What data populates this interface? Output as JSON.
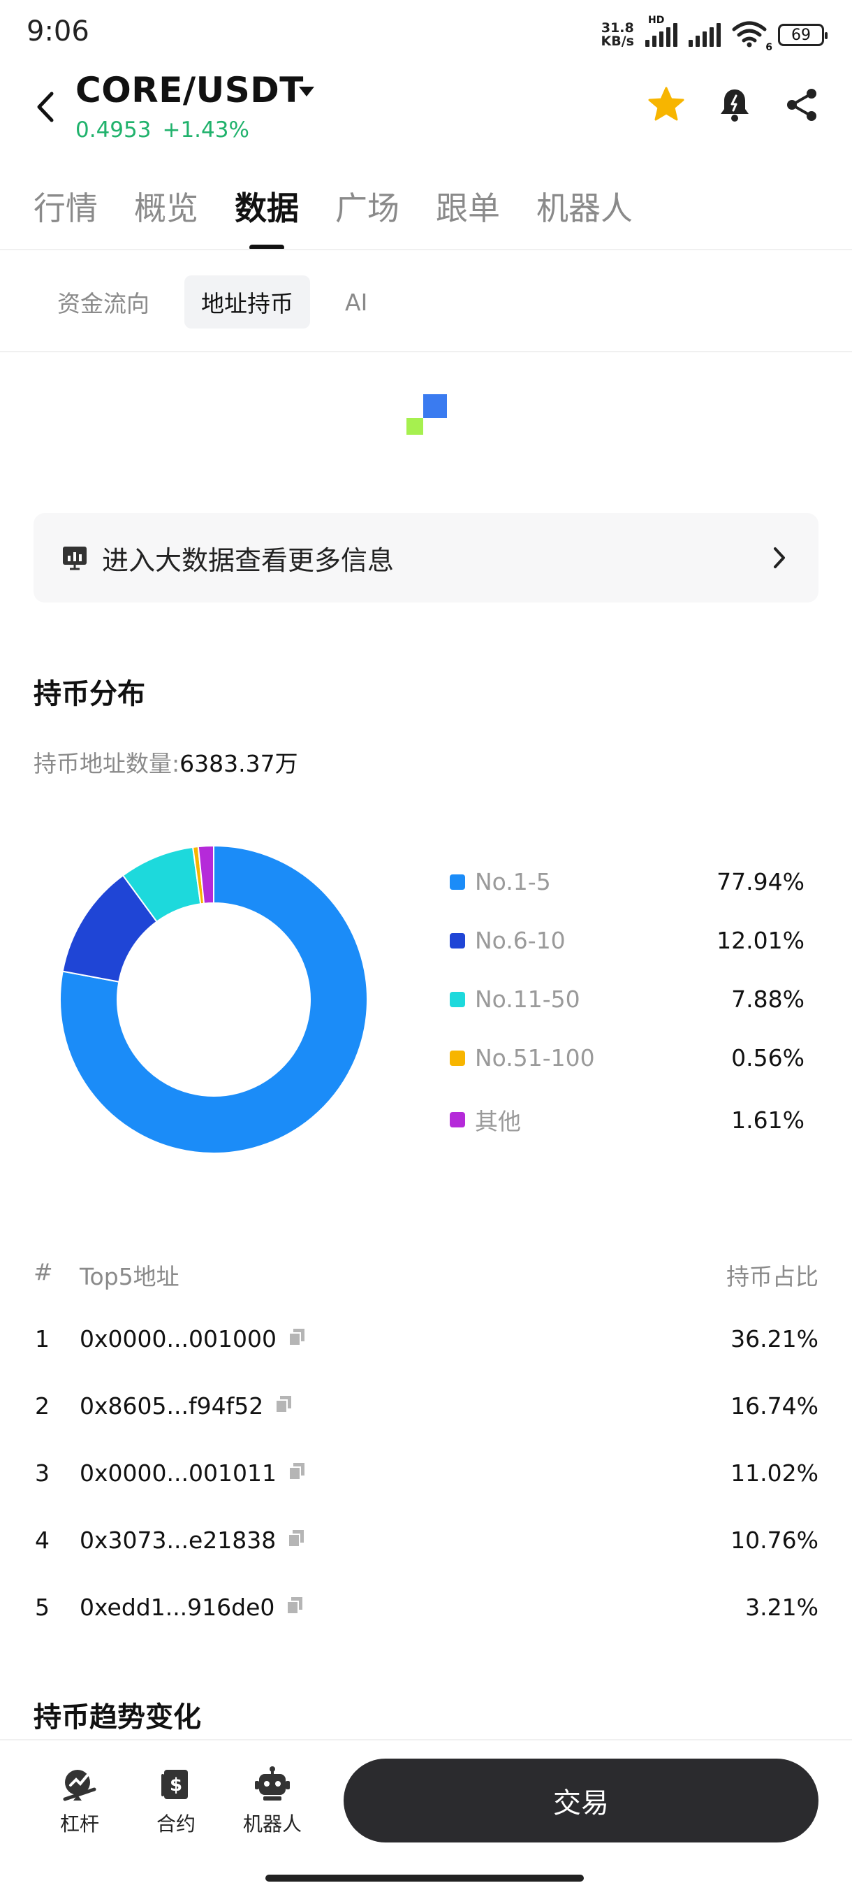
{
  "status_bar": {
    "time": "9:06",
    "net_speed_value": "31.8",
    "net_speed_unit": "KB/s",
    "hd": "HD",
    "wifi_sub": "6",
    "battery": "69"
  },
  "header": {
    "pair": "CORE/USDT",
    "price": "0.4953",
    "change": "+1.43%",
    "up_color": "#20b26c",
    "star_color": "#f7b500"
  },
  "main_tabs": [
    "行情",
    "概览",
    "数据",
    "广场",
    "跟单",
    "机器人"
  ],
  "main_tab_active": "数据",
  "sub_tabs": [
    "资金流向",
    "地址持币",
    "AI"
  ],
  "sub_tab_active": "地址持币",
  "banner": {
    "text": "进入大数据查看更多信息"
  },
  "distribution": {
    "title": "持币分布",
    "count_label": "持币地址数量:",
    "count_value": "6383.37万",
    "legend": [
      {
        "label": "No.1-5",
        "pct": "77.94%",
        "value": 77.94,
        "color": "#1b8cf8"
      },
      {
        "label": "No.6-10",
        "pct": "12.01%",
        "value": 12.01,
        "color": "#1f45d6"
      },
      {
        "label": "No.11-50",
        "pct": "7.88%",
        "value": 7.88,
        "color": "#1dd9dc"
      },
      {
        "label": "No.51-100",
        "pct": "0.56%",
        "value": 0.56,
        "color": "#f7b500"
      },
      {
        "label": "其他",
        "pct": "1.61%",
        "value": 1.61,
        "color": "#b52ad9"
      }
    ]
  },
  "chart_data": {
    "type": "pie",
    "categories": [
      "No.1-5",
      "No.6-10",
      "No.11-50",
      "No.51-100",
      "其他"
    ],
    "values": [
      77.94,
      12.01,
      7.88,
      0.56,
      1.61
    ]
  },
  "top5": {
    "col_index": "#",
    "col_address": "Top5地址",
    "col_share": "持币占比",
    "rows": [
      {
        "rank": "1",
        "address": "0x0000...001000",
        "share": "36.21%"
      },
      {
        "rank": "2",
        "address": "0x8605...f94f52",
        "share": "16.74%"
      },
      {
        "rank": "3",
        "address": "0x0000...001011",
        "share": "11.02%"
      },
      {
        "rank": "4",
        "address": "0x3073...e21838",
        "share": "10.76%"
      },
      {
        "rank": "5",
        "address": "0xedd1...916de0",
        "share": "3.21%"
      }
    ]
  },
  "trend": {
    "title": "持币趋势变化"
  },
  "bottom_nav": {
    "items": [
      "杠杆",
      "合约",
      "机器人"
    ],
    "trade_label": "交易"
  }
}
